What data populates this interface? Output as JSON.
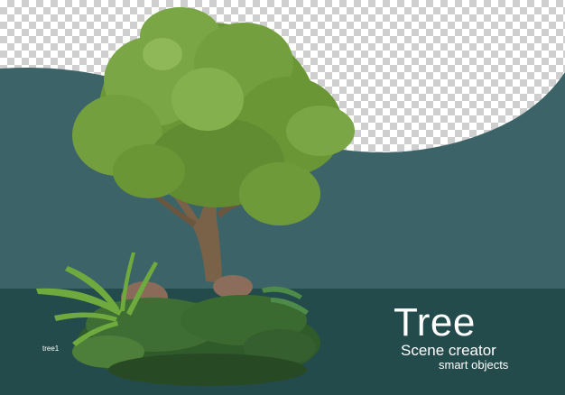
{
  "caption": {
    "title": "Tree",
    "subtitle": "Scene creator",
    "tagline": "smart objects"
  },
  "object_label": "tree1",
  "colors": {
    "backdrop": "#3c6468",
    "floor": "#244b4c",
    "checker_light": "#ffffff",
    "checker_dark": "#cfcfcf",
    "foliage": "#6f9a3a",
    "trunk": "#7a6248",
    "text": "#ffffff"
  }
}
